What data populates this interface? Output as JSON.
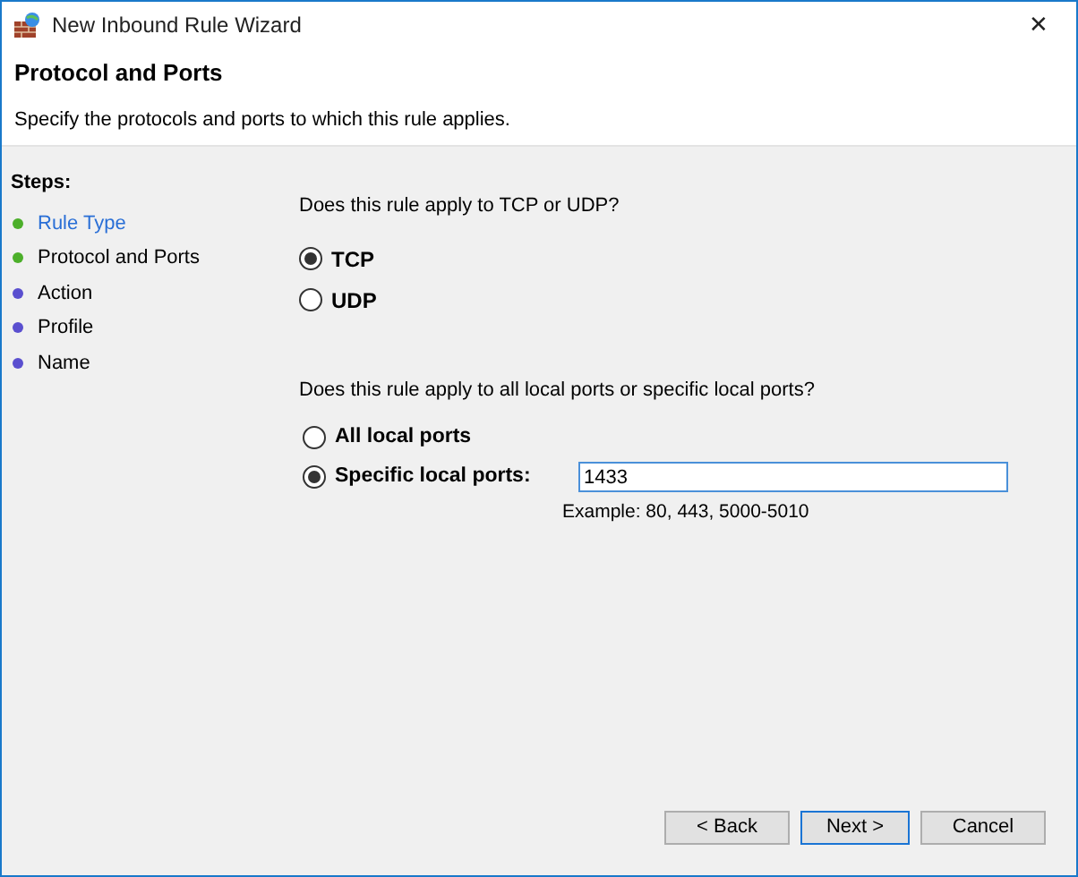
{
  "window": {
    "title": "New Inbound Rule Wizard",
    "close": "✕"
  },
  "header": {
    "title": "Protocol and Ports",
    "subtitle": "Specify the protocols and ports to which this rule applies."
  },
  "steps": {
    "heading": "Steps:",
    "items": [
      {
        "label": "Rule Type",
        "color": "#4caf2a",
        "link": true
      },
      {
        "label": "Protocol and Ports",
        "color": "#4caf2a",
        "link": false
      },
      {
        "label": "Action",
        "color": "#5a4fcf",
        "link": false
      },
      {
        "label": "Profile",
        "color": "#5a4fcf",
        "link": false
      },
      {
        "label": "Name",
        "color": "#5a4fcf",
        "link": false
      }
    ]
  },
  "protocol": {
    "question": "Does this rule apply to TCP or UDP?",
    "options": [
      {
        "label": "TCP",
        "selected": true
      },
      {
        "label": "UDP",
        "selected": false
      }
    ]
  },
  "ports": {
    "question": "Does this rule apply to all local ports or specific local ports?",
    "options": [
      {
        "label": "All local ports",
        "selected": false
      },
      {
        "label": "Specific local ports:",
        "selected": true
      }
    ],
    "value": "1433",
    "example": "Example: 80, 443, 5000-5010"
  },
  "buttons": [
    {
      "label": "< Back",
      "default": false
    },
    {
      "label": "Next >",
      "default": true
    },
    {
      "label": "Cancel",
      "default": false
    }
  ]
}
